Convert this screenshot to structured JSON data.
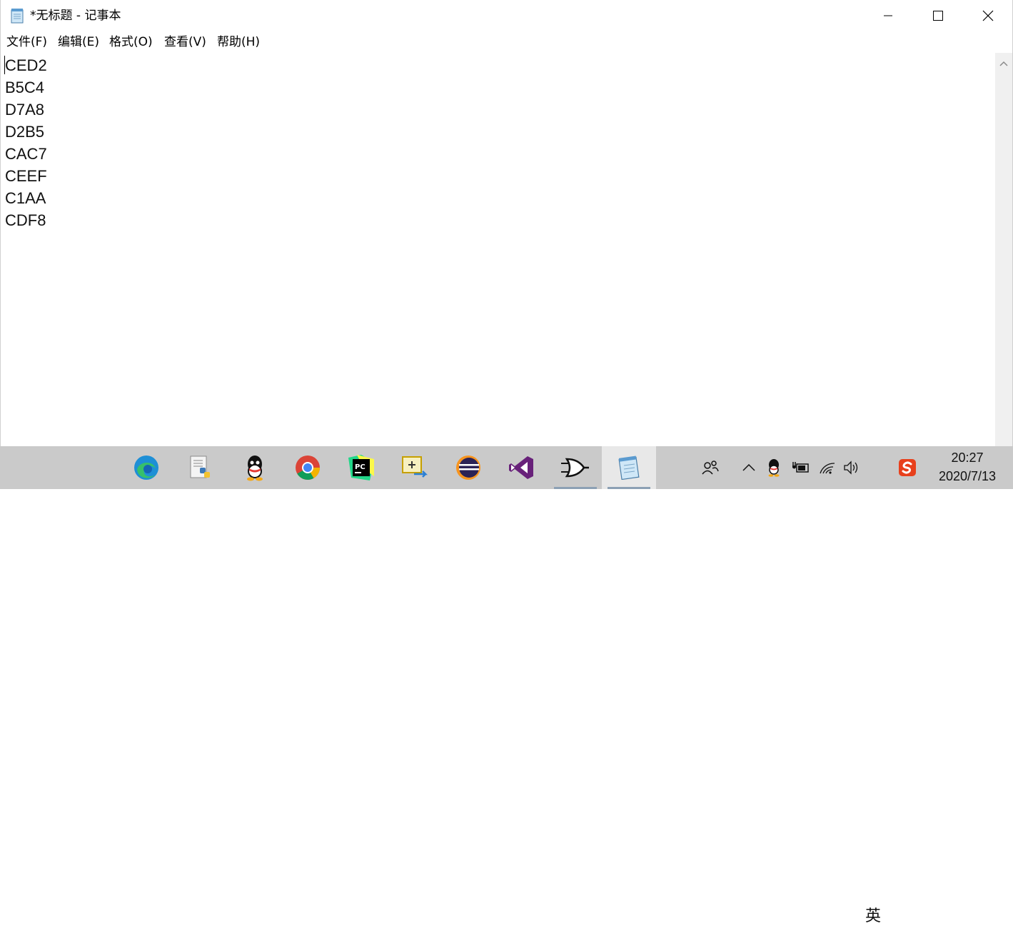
{
  "window": {
    "title": "*无标题 - 记事本"
  },
  "menu": [
    {
      "label": "文件(F)"
    },
    {
      "label": "编辑(E)"
    },
    {
      "label": "格式(O)"
    },
    {
      "label": "查看(V)"
    },
    {
      "label": "帮助(H)"
    }
  ],
  "editor": {
    "lines": [
      "CED2",
      "B5C4",
      "D7A8",
      "D2B5",
      "CAC7",
      "CEEF",
      "C1AA",
      "CDF8"
    ]
  },
  "taskbar": {
    "apps": [
      {
        "icon": "edge-icon"
      },
      {
        "icon": "python-idle-icon"
      },
      {
        "icon": "qq-icon"
      },
      {
        "icon": "chrome-icon"
      },
      {
        "icon": "pycharm-icon"
      },
      {
        "icon": "snipping-tool-icon"
      },
      {
        "icon": "eclipse-icon"
      },
      {
        "icon": "visual-studio-icon"
      },
      {
        "icon": "logic-gate-app-icon"
      },
      {
        "icon": "notepad-icon",
        "active": true
      }
    ],
    "tray": {
      "ime_label": "英",
      "time": "20:27",
      "date": "2020/7/13"
    }
  },
  "colors": {
    "taskbar_bg": "#cacaca",
    "active_app_bg": "#e8e8e8"
  }
}
